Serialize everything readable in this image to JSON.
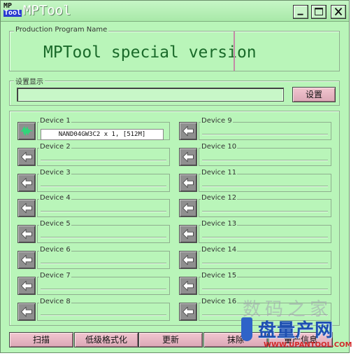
{
  "window": {
    "title": "MPTool",
    "icon_lines": [
      "MP",
      "Tool"
    ]
  },
  "title_buttons": {
    "minimize_icon": "minimize-icon",
    "maximize_icon": "maximize-icon",
    "close_icon": "close-icon"
  },
  "production": {
    "legend": "Production Program Name",
    "title": "MPTool special version"
  },
  "settings": {
    "legend": "设置显示",
    "value": "",
    "button_label": "设置"
  },
  "devices": [
    {
      "label": "Device 1",
      "value": "NAND04GW3C2 x 1, [512M]",
      "active": true
    },
    {
      "label": "Device 2",
      "value": "",
      "active": false
    },
    {
      "label": "Device 3",
      "value": "",
      "active": false
    },
    {
      "label": "Device 4",
      "value": "",
      "active": false
    },
    {
      "label": "Device 5",
      "value": "",
      "active": false
    },
    {
      "label": "Device 6",
      "value": "",
      "active": false
    },
    {
      "label": "Device 7",
      "value": "",
      "active": false
    },
    {
      "label": "Device 8",
      "value": "",
      "active": false
    },
    {
      "label": "Device 9",
      "value": "",
      "active": false
    },
    {
      "label": "Device 10",
      "value": "",
      "active": false
    },
    {
      "label": "Device 11",
      "value": "",
      "active": false
    },
    {
      "label": "Device 12",
      "value": "",
      "active": false
    },
    {
      "label": "Device 13",
      "value": "",
      "active": false
    },
    {
      "label": "Device 14",
      "value": "",
      "active": false
    },
    {
      "label": "Device 15",
      "value": "",
      "active": false
    },
    {
      "label": "Device 16",
      "value": "",
      "active": false
    }
  ],
  "bottom_buttons": [
    {
      "label": "扫描"
    },
    {
      "label": "低级格式化"
    },
    {
      "label": "更新"
    },
    {
      "label": "抹除"
    },
    {
      "label": "量产信息"
    }
  ],
  "watermark": {
    "top": "数码之家",
    "mid": "盘量产网",
    "url": "WWW.UPANTOOL.COM"
  },
  "colors": {
    "window_bg": "#b9f5b9",
    "button_bg": "#dba8b6",
    "device_active_icon": "#2fd67a"
  }
}
